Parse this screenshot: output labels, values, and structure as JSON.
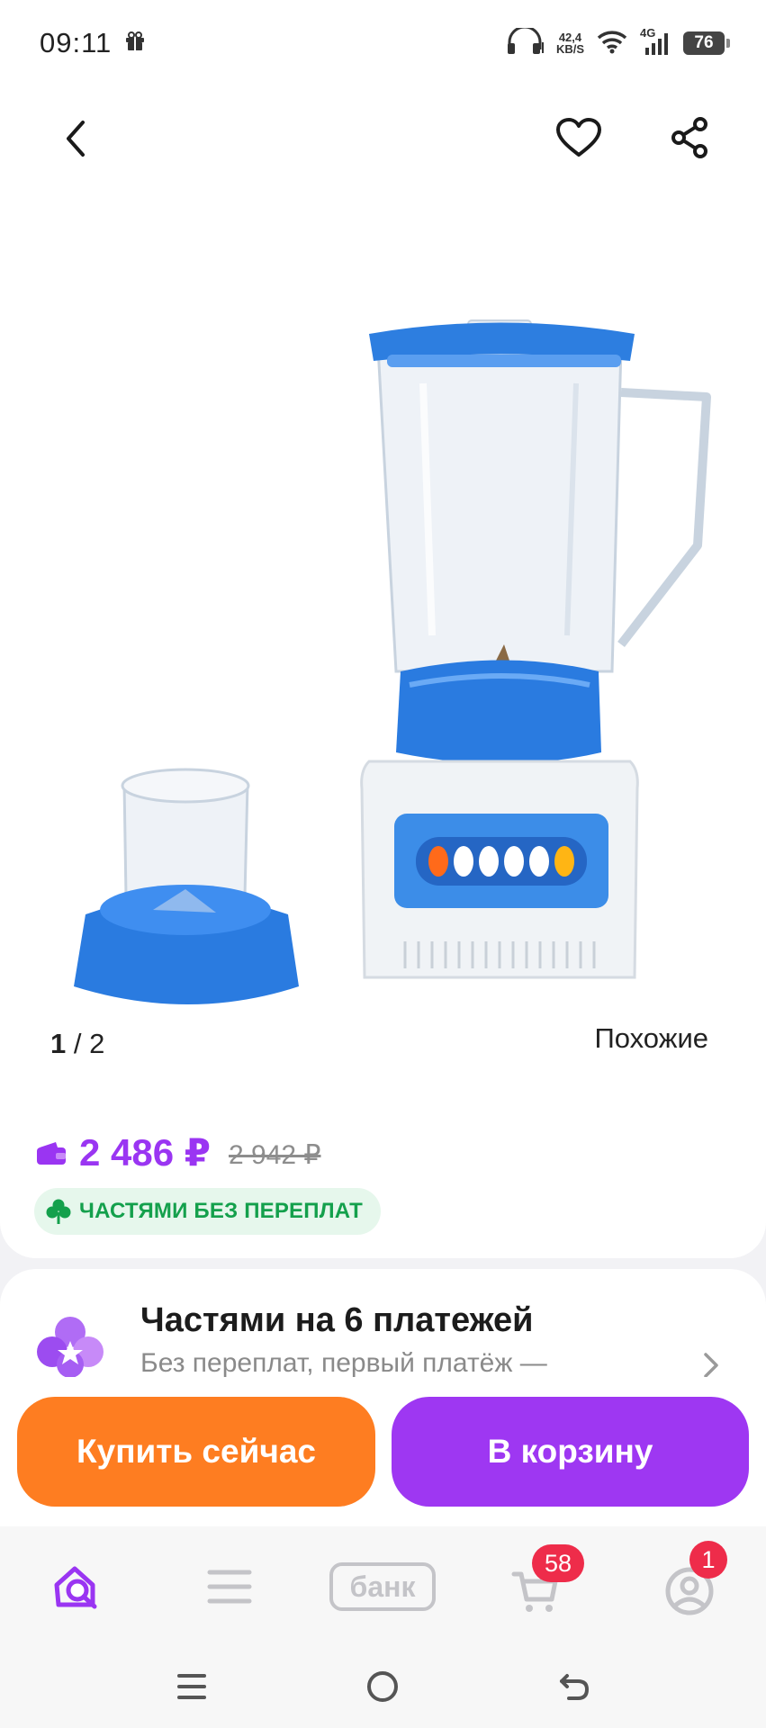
{
  "status_bar": {
    "time": "09:11",
    "net_speed_value": "42,4",
    "net_speed_unit": "KB/S",
    "network": "4G",
    "battery": "76"
  },
  "nav": {
    "back_icon": "chevron-left-icon",
    "favorite_icon": "heart-icon",
    "share_icon": "share-icon"
  },
  "gallery": {
    "current": "1",
    "separator": " / ",
    "total": "2",
    "similar_label": "Похожие"
  },
  "price": {
    "current": "2 486 ₽",
    "old": "2 942 ₽",
    "accent": "#9a35f2"
  },
  "installment_badge": {
    "label": "ЧАСТЯМИ БЕЗ ПЕРЕПЛАТ",
    "color": "#14a04c"
  },
  "installment_card": {
    "title": "Частями на 6 платежей",
    "subtitle": "Без переплат, первый платёж —"
  },
  "actions": {
    "buy_now": "Купить сейчас",
    "add_to_cart": "В корзину",
    "buy_color": "#fe7d21",
    "cart_color": "#9e37f2"
  },
  "tabs": {
    "home_icon": "search-home-icon",
    "catalog_icon": "menu-icon",
    "bank_label": "банк",
    "cart_icon": "cart-icon",
    "cart_badge": "58",
    "profile_icon": "profile-icon",
    "profile_badge": "1"
  }
}
